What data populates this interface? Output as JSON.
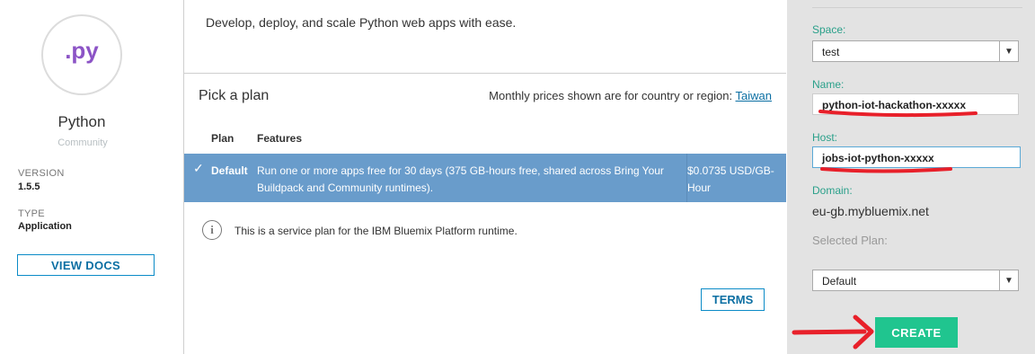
{
  "sidebar": {
    "logo_text": ".py",
    "app_name": "Python",
    "category": "Community",
    "version_label": "VERSION",
    "version_value": "1.5.5",
    "type_label": "TYPE",
    "type_value": "Application",
    "docs_button": "VIEW DOCS"
  },
  "main": {
    "description": "Develop, deploy, and scale Python web apps with ease.",
    "plan_title": "Pick a plan",
    "region_text": "Monthly prices shown are for country or region:",
    "region_link": "Taiwan",
    "columns": [
      "Plan",
      "Features"
    ],
    "plans": [
      {
        "check": "✓",
        "name": "Default",
        "features": "Run one or more apps free for 30 days (375 GB-hours free, shared across Bring Your Buildpack and Community runtimes).",
        "price": "$0.0735 USD/GB-Hour"
      }
    ],
    "info_icon": "info-icon",
    "info_text": "This is a service plan for the IBM Bluemix Platform runtime.",
    "terms_button": "TERMS"
  },
  "form": {
    "space_label": "Space:",
    "space_value": "test",
    "name_label": "Name:",
    "name_value": "python-iot-hackathon-xxxxx",
    "host_label": "Host:",
    "host_value": "jobs-iot-python-xxxxx",
    "domain_label": "Domain:",
    "domain_value": "eu-gb.mybluemix.net",
    "plan_label": "Selected Plan:",
    "plan_value": "Default",
    "create_button": "CREATE"
  },
  "colors": {
    "accent": "#20c58f",
    "link": "#0b6fa3",
    "plan_row": "#699ccb",
    "field_label": "#2aa08a",
    "annotation": "#e8202a"
  }
}
